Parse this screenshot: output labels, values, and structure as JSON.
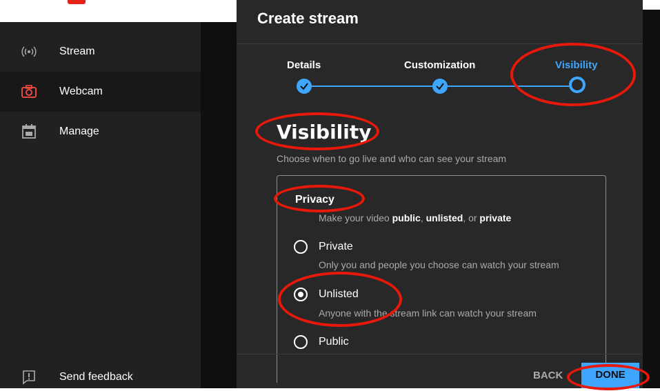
{
  "sidebar": {
    "items": [
      {
        "label": "Stream",
        "icon": "broadcast-icon"
      },
      {
        "label": "Webcam",
        "icon": "camera-icon",
        "active": true
      },
      {
        "label": "Manage",
        "icon": "calendar-icon"
      }
    ],
    "feedback": {
      "label": "Send feedback",
      "icon": "feedback-icon"
    }
  },
  "dialog": {
    "title": "Create stream",
    "steps": [
      {
        "label": "Details",
        "state": "done"
      },
      {
        "label": "Customization",
        "state": "done"
      },
      {
        "label": "Visibility",
        "state": "current"
      }
    ],
    "heading": "Visibility",
    "subheading": "Choose when to go live and who can see your stream",
    "privacy": {
      "title": "Privacy",
      "sub_prefix": "Make your video ",
      "sub_public": "public",
      "sub_sep1": ", ",
      "sub_unlisted": "unlisted",
      "sub_sep2": ", or ",
      "sub_private": "private",
      "options": [
        {
          "label": "Private",
          "desc": "Only you and people you choose can watch your stream",
          "selected": false
        },
        {
          "label": "Unlisted",
          "desc": "Anyone with the stream link can watch your stream",
          "selected": true
        },
        {
          "label": "Public",
          "desc": "",
          "selected": false
        }
      ]
    },
    "back_label": "BACK",
    "done_label": "DONE"
  },
  "colors": {
    "accent": "#3ea6ff",
    "annotation": "#e8190a",
    "sidebar_bg": "#212121",
    "dialog_bg": "#282828"
  }
}
